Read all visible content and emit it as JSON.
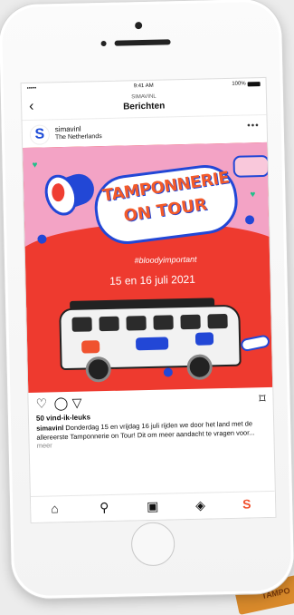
{
  "status": {
    "signal": "••••• ",
    "time": "9:41 AM",
    "battery": "100%"
  },
  "nav": {
    "back": "‹",
    "subtitle": "SIMAVINL",
    "title": "Berichten"
  },
  "post": {
    "username": "simavinl",
    "location": "The Netherlands",
    "more": "•••",
    "image": {
      "title_line1": "TAMPONNERIE",
      "title_line2": "ON TOUR",
      "hashtag": "#bloodyimportant",
      "dates": "15 en 16 juli 2021"
    },
    "likes": "50 vind-ik-leuks",
    "caption_user": "simavinl",
    "caption_text": " Donderdag 15 en vrijdag 16 juli rijden we door het land met de allereerste Tamponnerie on Tour! Dit om meer aandacht te vragen voor...",
    "caption_more": " meer"
  },
  "icons": {
    "heart": "♡",
    "comment": "◯",
    "share": "▽",
    "bookmark": "⌑",
    "home": "⌂",
    "search": "⚲",
    "reels": "▣",
    "shop": "◈",
    "profile": "S"
  },
  "colors": {
    "accent": "#f0522f",
    "brand_blue": "#1f4dd8",
    "poster_red": "#ee3a2f",
    "poster_pink": "#f3a3c5"
  },
  "corner_tag": "TAMPO"
}
